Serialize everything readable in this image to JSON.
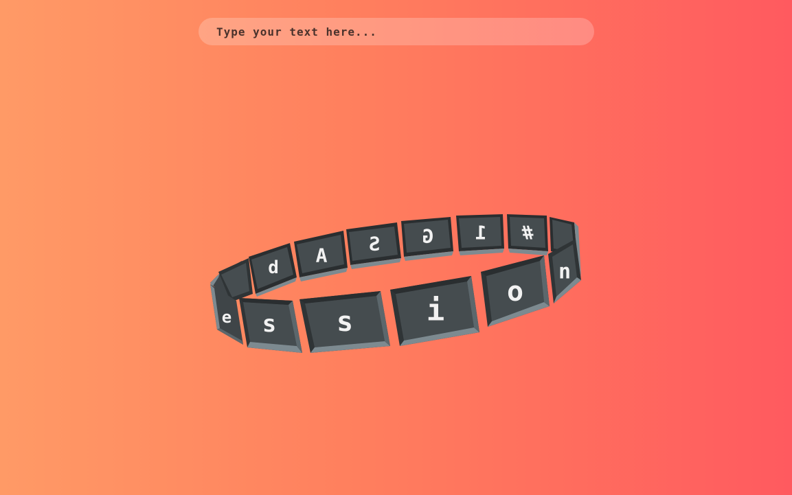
{
  "input": {
    "placeholder": "Type your text here...",
    "value": ""
  },
  "ring": {
    "front_tiles": [
      "e",
      "s",
      "s",
      "i",
      "o",
      "n"
    ],
    "back_tiles": [
      "",
      "",
      "b",
      "A",
      "S",
      "G",
      "1",
      "#",
      ""
    ],
    "colors": {
      "tile_face": "#3f4548",
      "tile_bevel_light": "#7d8a90",
      "tile_bevel_dark": "#2a2e30",
      "glyph": "#f2f2f2"
    }
  }
}
